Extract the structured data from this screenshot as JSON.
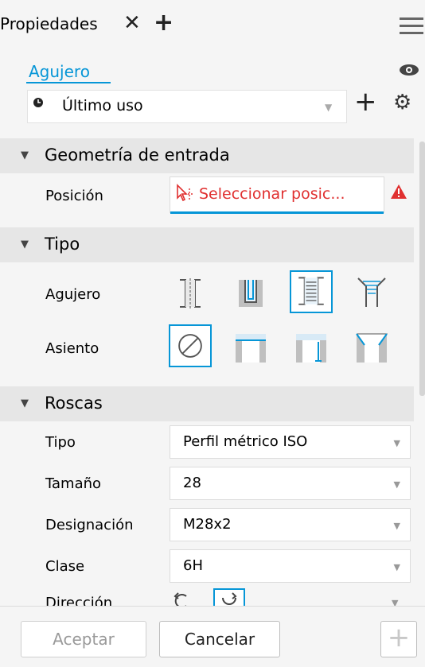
{
  "tab": {
    "label": "Propiedades",
    "close": "✕",
    "add": "+"
  },
  "feature": {
    "name": "Agujero"
  },
  "preset": {
    "value": "Último uso",
    "add": "+"
  },
  "sections": {
    "input_geometry": {
      "title": "Geometría de entrada",
      "position_label": "Posición",
      "position_value": "Seleccionar posic..."
    },
    "type": {
      "title": "Tipo",
      "hole_label": "Agujero",
      "seat_label": "Asiento"
    },
    "threads": {
      "title": "Roscas",
      "rows": [
        {
          "label": "Tipo",
          "value": "Perfil métrico ISO"
        },
        {
          "label": "Tamaño",
          "value": "28"
        },
        {
          "label": "Designación",
          "value": "M28x2"
        },
        {
          "label": "Clase",
          "value": "6H"
        }
      ],
      "direction_label": "Dirección"
    }
  },
  "footer": {
    "accept": "Aceptar",
    "cancel": "Cancelar",
    "add": "+"
  },
  "colors": {
    "accent": "#0696d7",
    "error": "#e03030"
  },
  "icons": [
    "close-icon",
    "plus-icon",
    "menu-icon",
    "eye-icon",
    "clock-icon",
    "gear-icon",
    "cursor-icon",
    "warning-icon",
    "direction-icon"
  ]
}
